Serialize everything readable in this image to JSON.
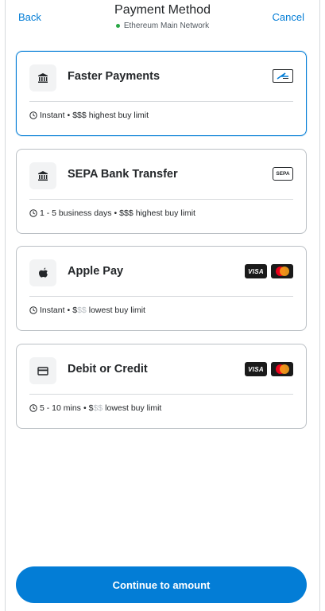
{
  "header": {
    "back_label": "Back",
    "title": "Payment Method",
    "network": "Ethereum Main Network",
    "cancel_label": "Cancel"
  },
  "methods": [
    {
      "title": "Faster Payments",
      "icon": "bank-icon",
      "badges": [
        "faster-payments-logo"
      ],
      "time": "Instant",
      "limit_strong": "$$$",
      "limit_faded": "",
      "limit_text": "highest buy limit",
      "selected": true
    },
    {
      "title": "SEPA Bank Transfer",
      "icon": "bank-icon",
      "badges": [
        "sepa-logo"
      ],
      "sepa_label": "SEPA",
      "time": "1 - 5 business days",
      "limit_strong": "$$$",
      "limit_faded": "",
      "limit_text": "highest buy limit",
      "selected": false
    },
    {
      "title": "Apple Pay",
      "icon": "apple-icon",
      "badges": [
        "visa-logo",
        "mastercard-logo"
      ],
      "visa_label": "VISA",
      "time": "Instant",
      "limit_strong": "$",
      "limit_faded": "$$",
      "limit_text": "lowest buy limit",
      "selected": false
    },
    {
      "title": "Debit or Credit",
      "icon": "credit-card-icon",
      "badges": [
        "visa-logo",
        "mastercard-logo"
      ],
      "visa_label": "VISA",
      "time": "5 - 10 mins",
      "limit_strong": "$",
      "limit_faded": "$$",
      "limit_text": "lowest buy limit",
      "selected": false
    }
  ],
  "separator": "•",
  "cta_label": "Continue to amount",
  "colors": {
    "accent": "#037dd6",
    "network_dot": "#28a745",
    "border": "#bbc0c5"
  }
}
